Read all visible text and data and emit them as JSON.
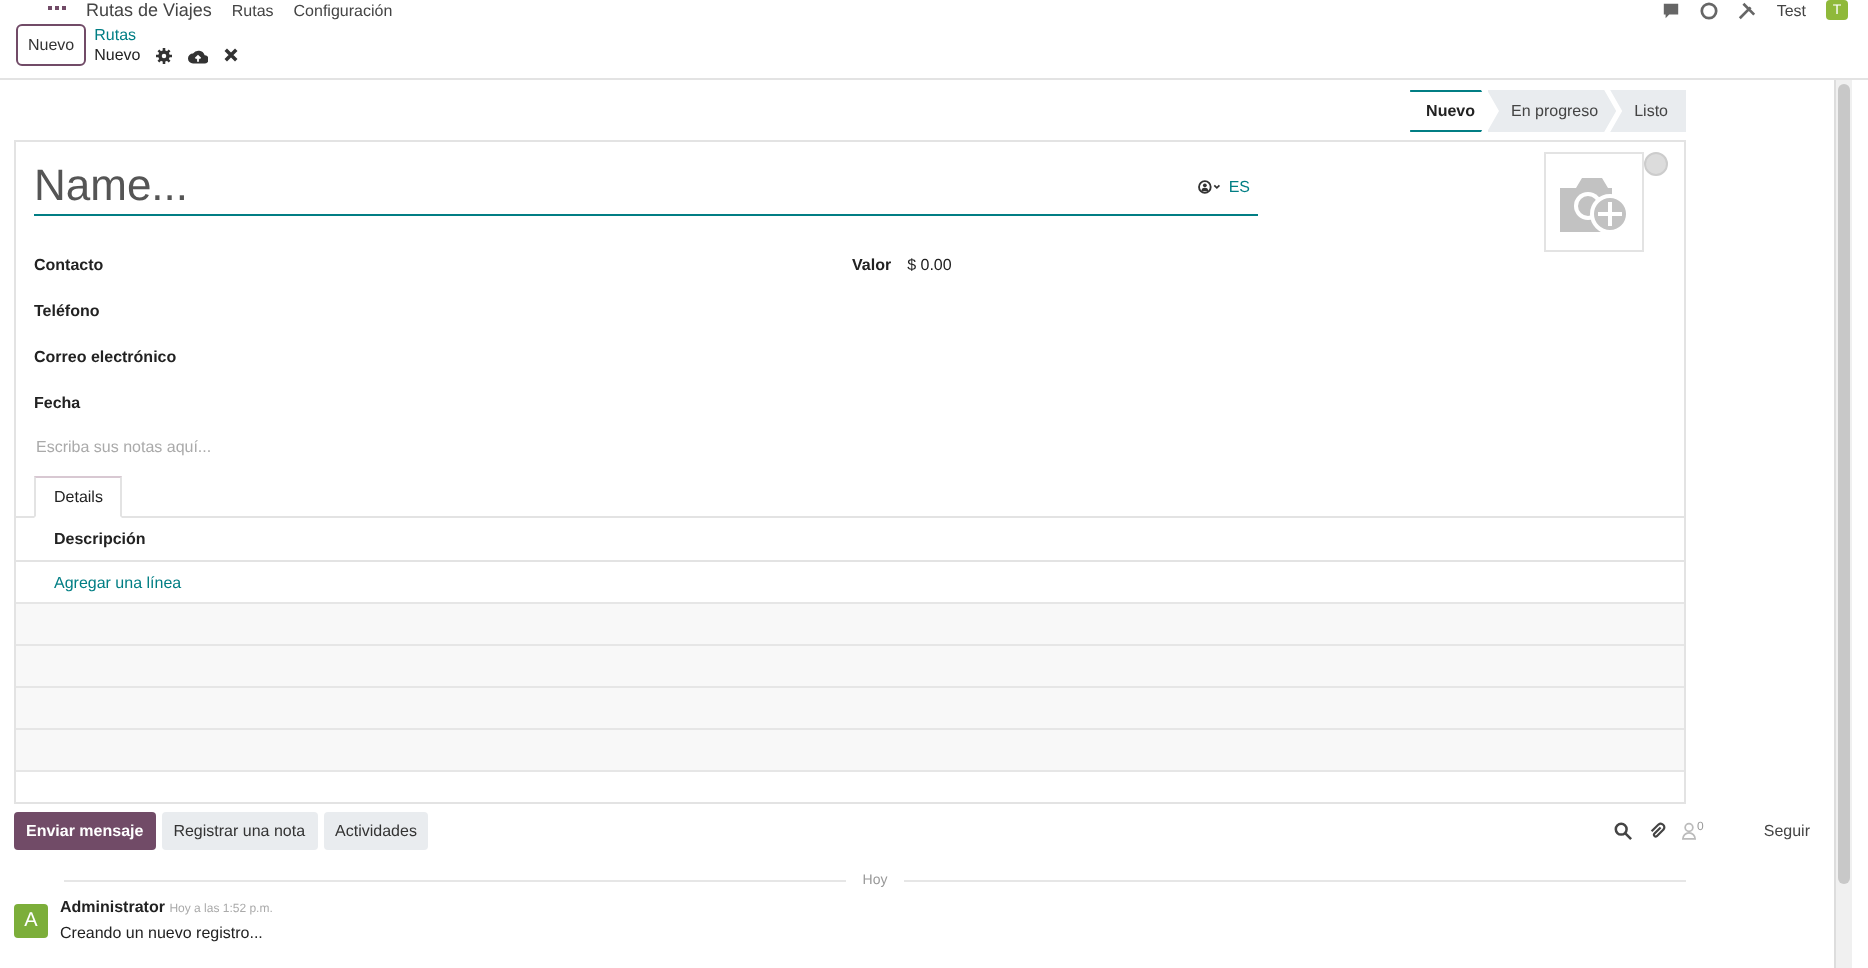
{
  "navbar": {
    "app_name": "Rutas de Viajes",
    "menus": [
      "Rutas",
      "Configuración"
    ],
    "user": "Test",
    "avatar_letter": "T"
  },
  "control_panel": {
    "new_button": "Nuevo",
    "breadcrumb": "Rutas",
    "record": "Nuevo"
  },
  "status_bar": [
    {
      "label": "Nuevo",
      "selected": true
    },
    {
      "label": "En progreso",
      "selected": false
    },
    {
      "label": "Listo",
      "selected": false
    }
  ],
  "form": {
    "name_placeholder": "Name...",
    "language": "ES",
    "left_fields": [
      {
        "label": "Contacto"
      },
      {
        "label": "Teléfono"
      },
      {
        "label": "Correo electrónico"
      },
      {
        "label": "Fecha"
      }
    ],
    "right_fields": [
      {
        "label": "Valor",
        "value": "$ 0.00"
      }
    ],
    "notes_placeholder": "Escriba sus notas aquí...",
    "tabs": [
      {
        "label": "Details",
        "selected": true
      }
    ],
    "table": {
      "columns": [
        "Descripción"
      ],
      "add_line": "Agregar una línea"
    }
  },
  "chatter": {
    "buttons": [
      {
        "label": "Enviar mensaje",
        "selected": true
      },
      {
        "label": "Registrar una nota",
        "selected": false
      },
      {
        "label": "Actividades",
        "selected": false
      }
    ],
    "follower_count": "0",
    "follow": "Seguir",
    "date_separator": "Hoy",
    "messages": [
      {
        "avatar_letter": "A",
        "author": "Administrator",
        "time": "Hoy a las 1:52 p.m.",
        "body": "Creando un nuevo registro..."
      }
    ]
  }
}
